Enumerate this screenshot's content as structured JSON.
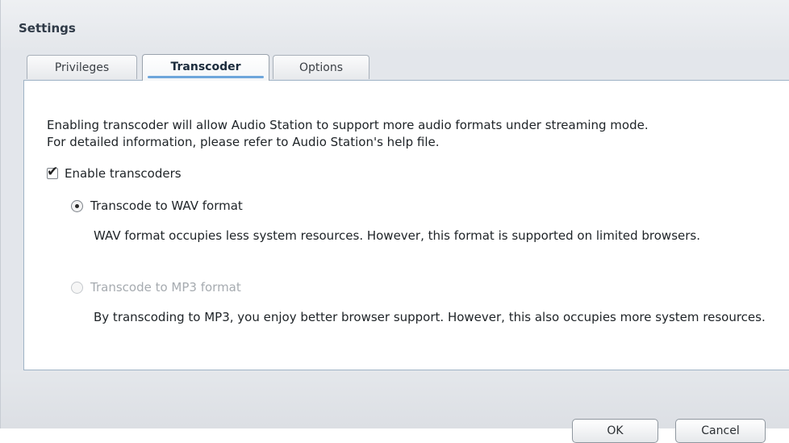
{
  "window": {
    "title": "Settings"
  },
  "tabs": [
    {
      "label": "Privileges",
      "active": false
    },
    {
      "label": "Transcoder",
      "active": true
    },
    {
      "label": "Options",
      "active": false
    }
  ],
  "transcoder": {
    "description_line1": "Enabling transcoder will allow Audio Station to support more audio formats under streaming mode.",
    "description_line2": "For detailed information, please refer to Audio Station's help file.",
    "enable_label": "Enable transcoders",
    "enable_checked": true,
    "wav_label": "Transcode to WAV format",
    "wav_selected": true,
    "wav_note": "WAV format occupies less system resources. However, this format is supported on limited browsers.",
    "mp3_label": "Transcode to MP3 format",
    "mp3_selected": false,
    "mp3_enabled": false,
    "mp3_note": "By transcoding to MP3, you enjoy better browser support. However, this also occupies more system resources."
  },
  "buttons": {
    "ok_label": "OK",
    "cancel_label": "Cancel"
  },
  "colors": {
    "accent_tab_underline": "#6ea6db",
    "panel_border": "#9fb3c6",
    "disabled_text": "#a6abb0"
  },
  "icons": {
    "checkbox": "checkbox-checked-icon",
    "radio_wav": "radio-selected-icon",
    "radio_mp3": "radio-unselected-icon"
  }
}
